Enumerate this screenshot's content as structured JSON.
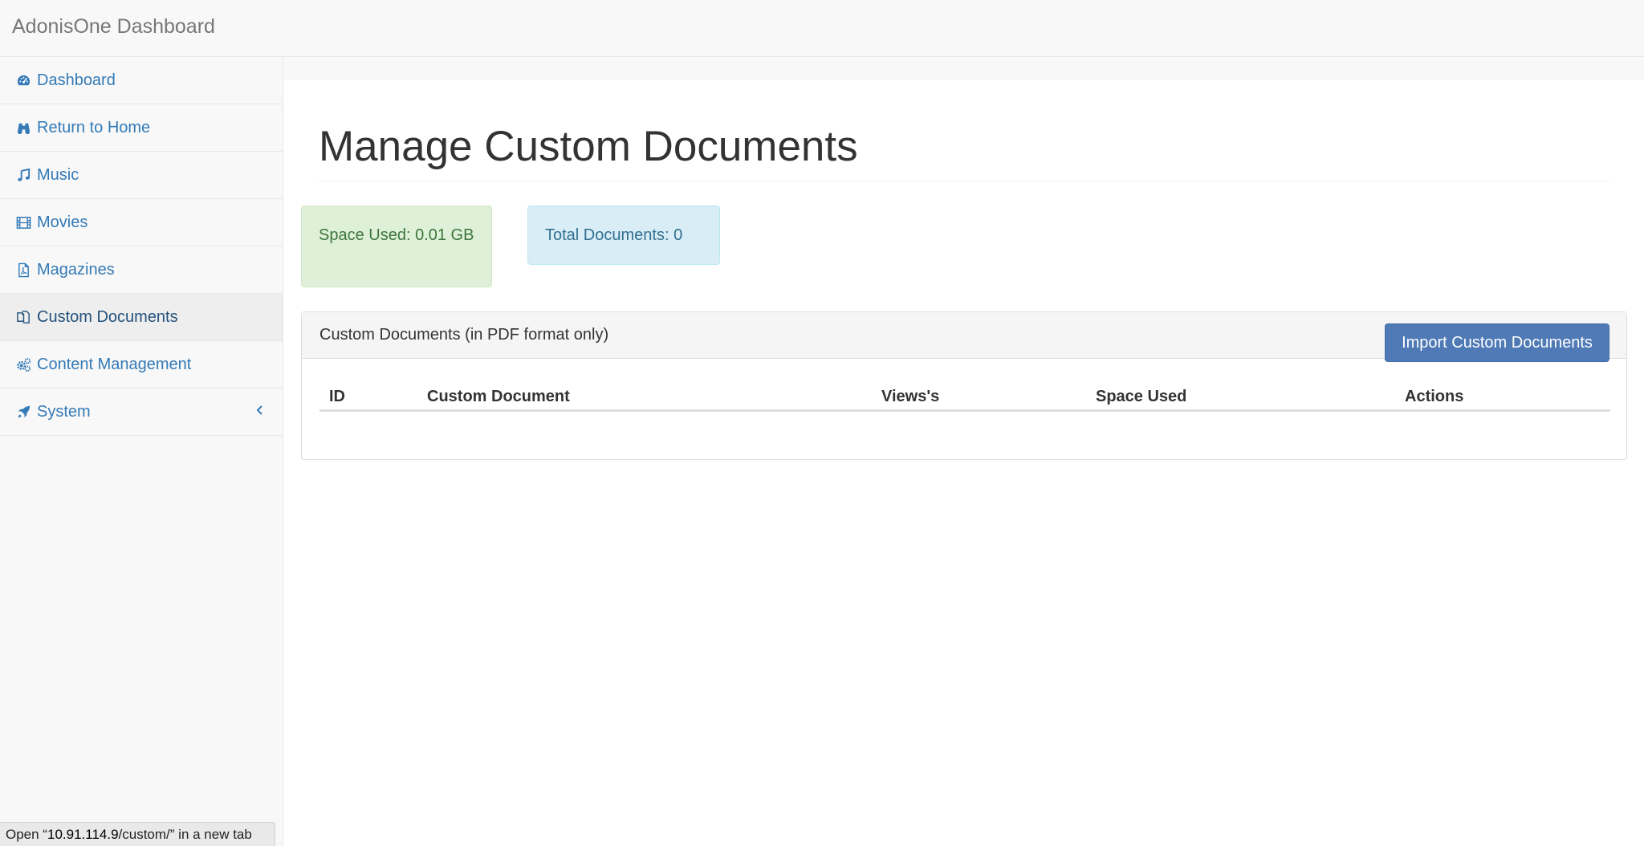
{
  "navbar": {
    "brand": "AdonisOne Dashboard"
  },
  "sidebar": {
    "items": [
      {
        "label": "Dashboard",
        "icon": "dashboard-icon"
      },
      {
        "label": "Return to Home",
        "icon": "binoculars-icon"
      },
      {
        "label": "Music",
        "icon": "music-note-icon"
      },
      {
        "label": "Movies",
        "icon": "film-icon"
      },
      {
        "label": "Magazines",
        "icon": "pdf-file-icon"
      },
      {
        "label": "Custom Documents",
        "icon": "copy-files-icon",
        "active": true
      },
      {
        "label": "Content Management",
        "icon": "gears-icon"
      },
      {
        "label": "System",
        "icon": "rocket-icon",
        "has_submenu": true
      }
    ]
  },
  "main": {
    "title": "Manage Custom Documents",
    "space_used": "Space Used: 0.01 GB",
    "total_documents": "Total Documents: 0",
    "panel": {
      "title": "Custom Documents (in PDF format only)",
      "import_button": "Import Custom Documents",
      "columns": [
        "ID",
        "Custom Document",
        "Views's",
        "Space Used",
        "Actions"
      ],
      "rows": []
    }
  },
  "status_bar": {
    "prefix": "Open “",
    "host": "10.91.114.9",
    "path": "/custom/",
    "suffix": "” in a new tab"
  },
  "colors": {
    "link": "#337ab7",
    "success_bg": "#dff0d8",
    "info_bg": "#d9edf7",
    "primary_button": "#4f7ab6"
  }
}
